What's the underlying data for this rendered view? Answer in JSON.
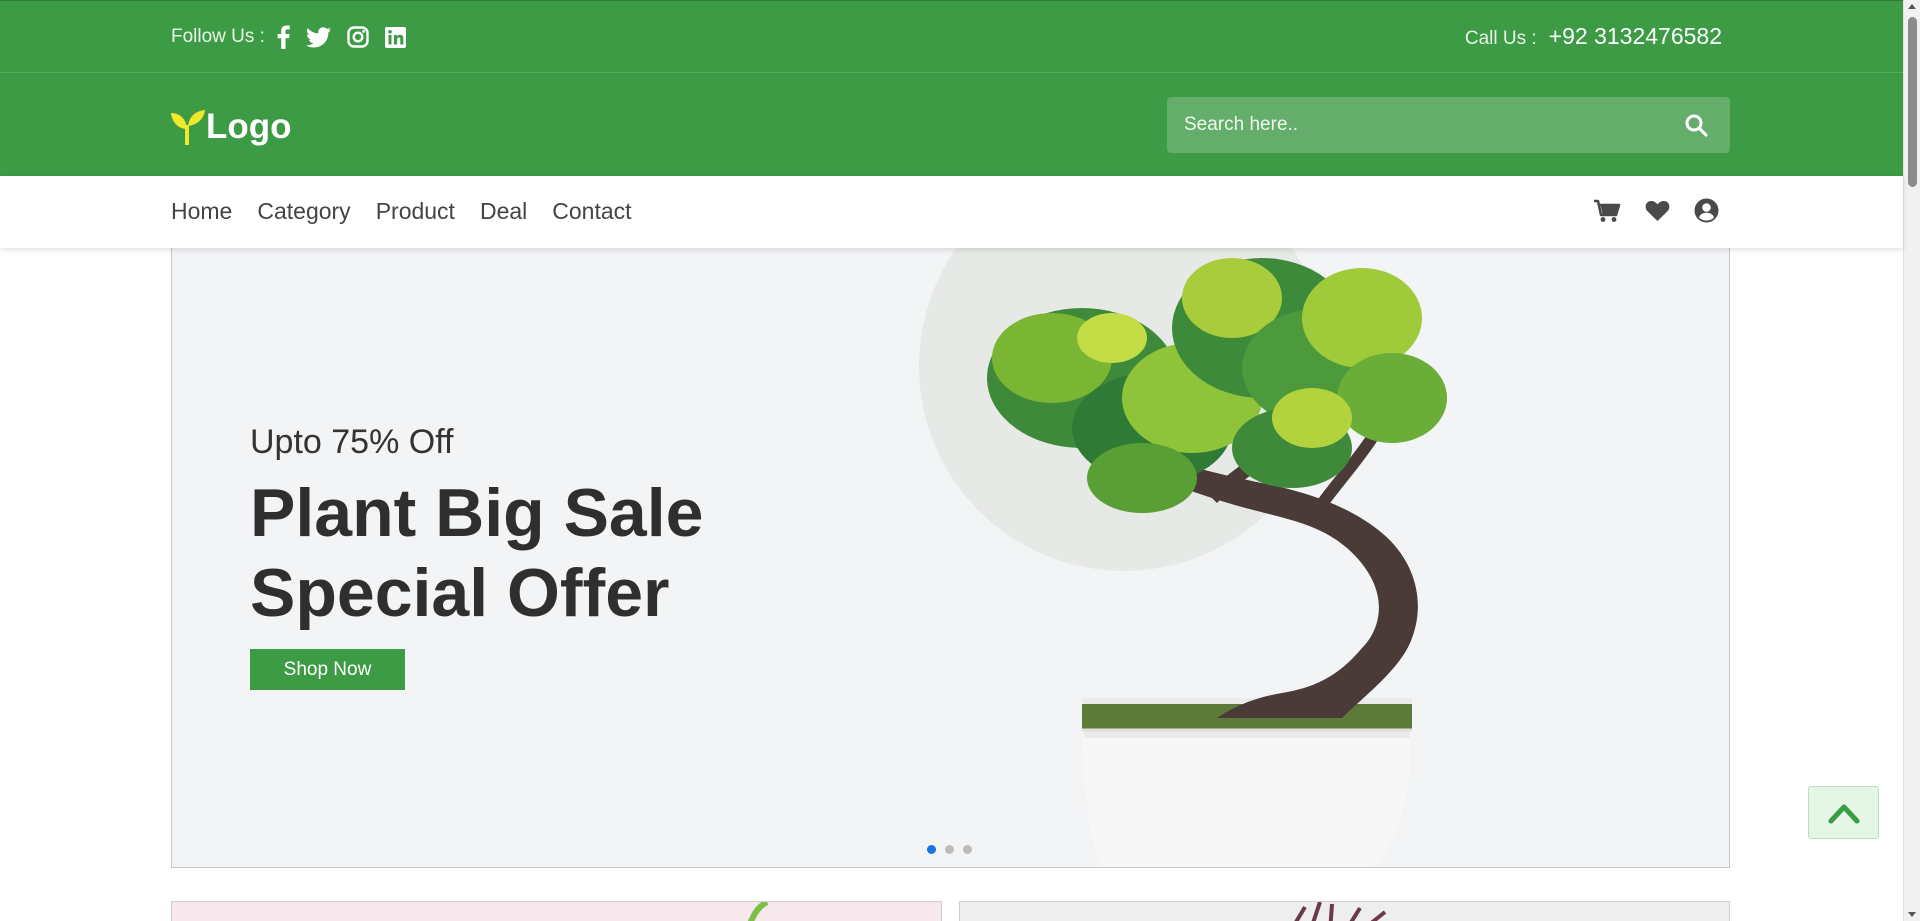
{
  "topbar": {
    "follow_label": "Follow Us :",
    "social": [
      "facebook-icon",
      "twitter-icon",
      "instagram-icon",
      "linkedin-icon"
    ],
    "call_label": "Call Us :",
    "phone": "+92 3132476582"
  },
  "header": {
    "logo_text": "Logo",
    "search_placeholder": "Search here.."
  },
  "nav": {
    "items": [
      {
        "label": "Home"
      },
      {
        "label": "Category"
      },
      {
        "label": "Product"
      },
      {
        "label": "Deal"
      },
      {
        "label": "Contact"
      }
    ],
    "icons": [
      "cart-icon",
      "heart-icon",
      "user-icon"
    ]
  },
  "hero": {
    "subtitle": "Upto 75% Off",
    "title_line1": "Plant Big Sale",
    "title_line2": "Special Offer",
    "cta": "Shop Now",
    "active_slide": 1,
    "slide_count": 3
  },
  "colors": {
    "brand_green": "#3c9b44",
    "search_bg": "#64ad6a",
    "hero_bg": "#f3f4f6",
    "active_dot": "#1a73e8"
  }
}
